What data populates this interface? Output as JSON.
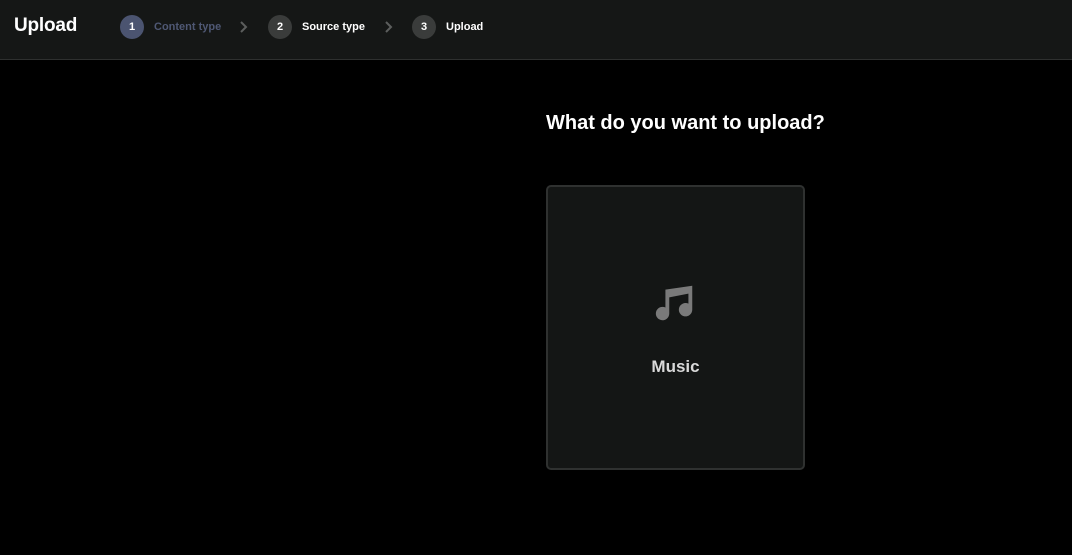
{
  "header": {
    "title": "Upload"
  },
  "steps": [
    {
      "number": "1",
      "label": "Content type",
      "state": "active"
    },
    {
      "number": "2",
      "label": "Source type",
      "state": "pending"
    },
    {
      "number": "3",
      "label": "Upload",
      "state": "pending"
    }
  ],
  "main": {
    "question": "What do you want to upload?",
    "options": [
      {
        "label": "Music",
        "icon": "music-note-icon"
      }
    ]
  },
  "colors": {
    "background": "#000000",
    "topbar": "#151716",
    "active_step": "#4b5470",
    "card": "#141615",
    "icon": "#7a7a7a"
  }
}
